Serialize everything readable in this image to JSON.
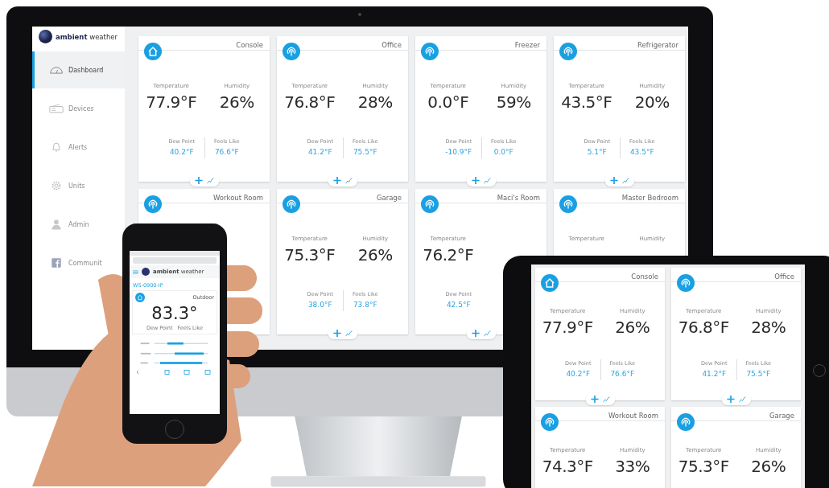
{
  "monitor": {
    "brand": "**ambient** weather",
    "sidebar": {
      "items": [
        {
          "label": "Dashboard",
          "kind": "gauge",
          "selected": true
        },
        {
          "label": "Devices",
          "kind": "radio",
          "selected": false
        },
        {
          "label": "Alerts",
          "kind": "bell",
          "selected": false
        },
        {
          "label": "Units",
          "kind": "gear",
          "selected": false
        },
        {
          "label": "Admin",
          "kind": "user",
          "selected": false
        },
        {
          "label": "Communit",
          "kind": "facebook",
          "selected": false
        }
      ]
    },
    "cards": [
      {
        "name": "Console",
        "kind": "home",
        "stats": [
          {
            "label": "Temperature",
            "value": "77.9°F"
          },
          {
            "label": "Humidity",
            "value": "26%"
          }
        ],
        "details": [
          {
            "label": "Dew Point",
            "value": "40.2°F"
          },
          {
            "label": "Feels Like",
            "value": "76.6°F"
          }
        ],
        "actions": true
      },
      {
        "name": "Office",
        "kind": "sensor",
        "stats": [
          {
            "label": "Temperature",
            "value": "76.8°F"
          },
          {
            "label": "Humidity",
            "value": "28%"
          }
        ],
        "details": [
          {
            "label": "Dew Point",
            "value": "41.2°F"
          },
          {
            "label": "Feels Like",
            "value": "75.5°F"
          }
        ],
        "actions": true
      },
      {
        "name": "Freezer",
        "kind": "sensor",
        "stats": [
          {
            "label": "Temperature",
            "value": "0.0°F"
          },
          {
            "label": "Humidity",
            "value": "59%"
          }
        ],
        "details": [
          {
            "label": "Dew Point",
            "value": "-10.9°F"
          },
          {
            "label": "Feels Like",
            "value": "0.0°F"
          }
        ],
        "actions": true
      },
      {
        "name": "Refrigerator",
        "kind": "sensor",
        "stats": [
          {
            "label": "Temperature",
            "value": "43.5°F"
          },
          {
            "label": "Humidity",
            "value": "20%"
          }
        ],
        "details": [
          {
            "label": "Dew Point",
            "value": "5.1°F"
          },
          {
            "label": "Feels Like",
            "value": "43.5°F"
          }
        ],
        "actions": true
      },
      {
        "name": "Workout Room",
        "kind": "sensor",
        "actions": false
      },
      {
        "name": "Garage",
        "kind": "sensor",
        "stats": [
          {
            "label": "Temperature",
            "value": "75.3°F"
          },
          {
            "label": "Humidity",
            "value": "26%"
          }
        ],
        "details": [
          {
            "label": "Dew Point",
            "value": "38.0°F"
          },
          {
            "label": "Feels Like",
            "value": "73.8°F"
          }
        ],
        "actions": true
      },
      {
        "name": "Maci's Room",
        "kind": "sensor",
        "stats": [
          {
            "label": "Temperature",
            "value": "76.2°F"
          }
        ],
        "details": [
          {
            "label": "Dew Point",
            "value": "42.5°F"
          }
        ],
        "actions": true
      },
      {
        "name": "Master Bedroom",
        "kind": "sensor",
        "stats": [
          {
            "label": "Temperature"
          },
          {
            "label": "Humidity"
          }
        ],
        "actions": false
      }
    ]
  },
  "phone": {
    "brand": "**ambient** weather",
    "device": "WS-0900-IP",
    "station": "Outdoor",
    "temperature": "83.3°",
    "details": [
      {
        "label": "Dew Point"
      },
      {
        "label": "Feels Like"
      }
    ]
  },
  "tablet": {
    "cards": [
      {
        "name": "Console",
        "kind": "home",
        "stats": [
          {
            "label": "Temperature",
            "value": "77.9°F"
          },
          {
            "label": "Humidity",
            "value": "26%"
          }
        ],
        "details": [
          {
            "label": "Dew Point",
            "value": "40.2°F"
          },
          {
            "label": "Feels Like",
            "value": "76.6°F"
          }
        ],
        "actions": true
      },
      {
        "name": "Office",
        "kind": "sensor",
        "stats": [
          {
            "label": "Temperature",
            "value": "76.8°F"
          },
          {
            "label": "Humidity",
            "value": "28%"
          }
        ],
        "details": [
          {
            "label": "Dew Point",
            "value": "41.2°F"
          },
          {
            "label": "Feels Like",
            "value": "75.5°F"
          }
        ],
        "actions": true
      },
      {
        "name": "Workout Room",
        "kind": "sensor",
        "stats": [
          {
            "label": "Temperature",
            "value": "74.3°F"
          },
          {
            "label": "Humidity",
            "value": "33%"
          }
        ],
        "actions": false
      },
      {
        "name": "Garage",
        "kind": "sensor",
        "stats": [
          {
            "label": "Temperature",
            "value": "75.3°F"
          },
          {
            "label": "Humidity",
            "value": "26%"
          }
        ],
        "actions": false
      }
    ]
  }
}
